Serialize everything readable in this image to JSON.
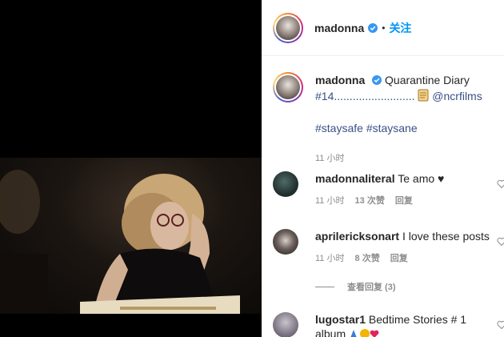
{
  "post": {
    "author": "madonna",
    "follow_label": "关注",
    "dot": "•"
  },
  "caption": {
    "username": "madonna",
    "text_prefix": "Quarantine Diary",
    "text_line2": "#14..........................",
    "mention": "@ncrfilms",
    "hashtags": "#staysafe #staysane",
    "time": "11 小时"
  },
  "comments": [
    {
      "username": "madonnaliteral",
      "text": "Te amo ♥",
      "time": "11 小时",
      "likes": "13 次赞",
      "reply": "回复"
    },
    {
      "username": "aprilericksonart",
      "text": "I love these posts",
      "time": "11 小时",
      "likes": "8 次赞",
      "reply": "回复"
    },
    {
      "username": "lugostar1",
      "text": "Bedtime Stories # 1",
      "text2": "album"
    }
  ],
  "view_replies": "查看回复 (3)",
  "colors": {
    "link": "#385185",
    "follow": "#0095f6",
    "secondary": "#8e8e8e"
  },
  "icons": [
    "verified-badge-icon",
    "notebook-emoji-icon",
    "heart-icon",
    "emoji-icons"
  ]
}
